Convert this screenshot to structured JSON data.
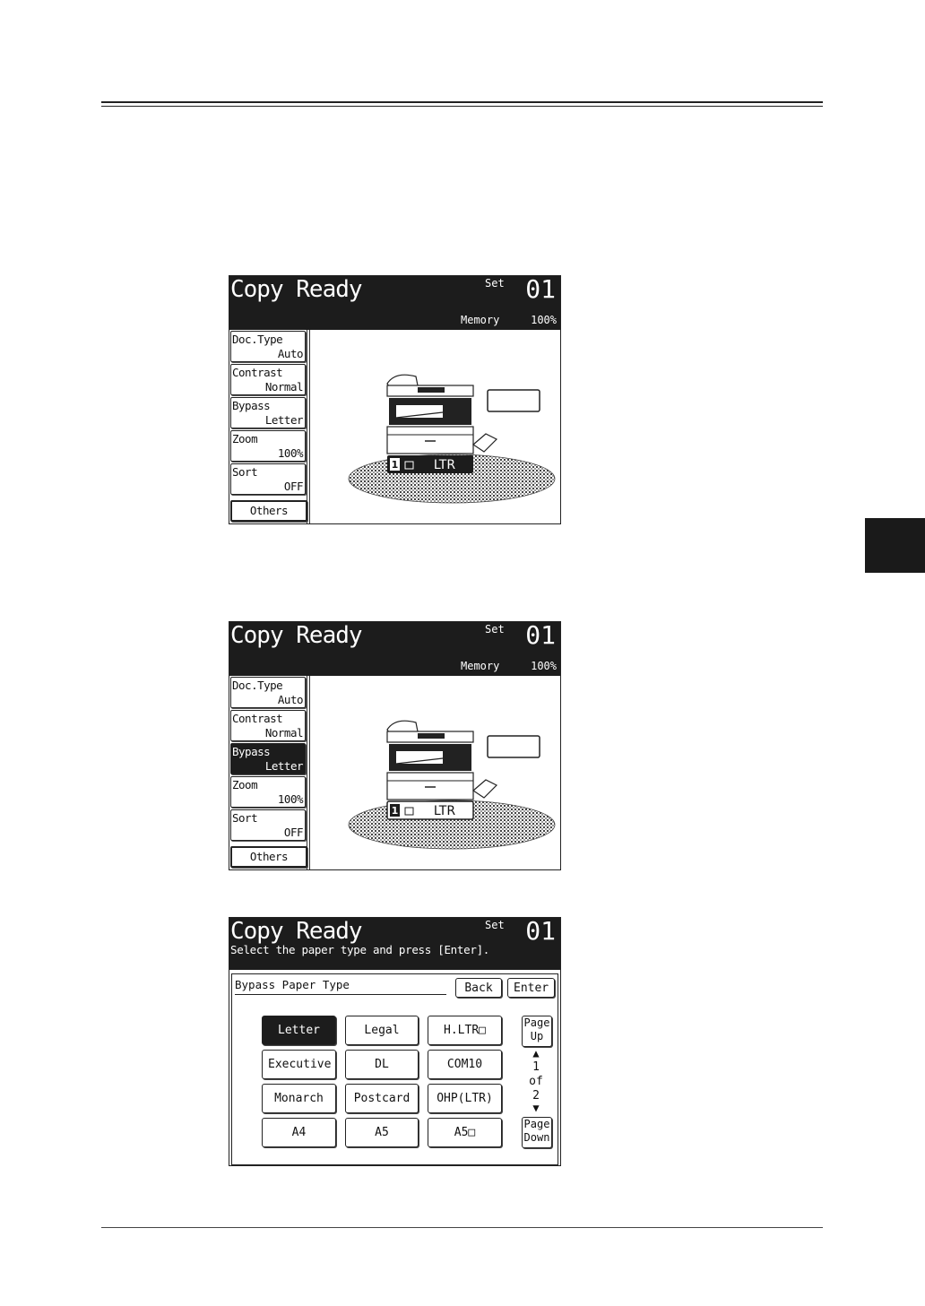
{
  "screens": [
    {
      "title": "Copy Ready",
      "set_label": "Set",
      "set_count": "01",
      "memory_label": "Memory",
      "memory_value": "100%",
      "sidebar": [
        {
          "label": "Doc.Type",
          "value": "Auto"
        },
        {
          "label": "Contrast",
          "value": "Normal"
        },
        {
          "label": "Bypass",
          "value": "Letter"
        },
        {
          "label": "Zoom",
          "value": "100%"
        },
        {
          "label": "Sort",
          "value": "OFF"
        }
      ],
      "others_label": "Others",
      "tray_number": "1",
      "tray_paper": "LTR"
    },
    {
      "title": "Copy Ready",
      "set_label": "Set",
      "set_count": "01",
      "memory_label": "Memory",
      "memory_value": "100%",
      "sidebar": [
        {
          "label": "Doc.Type",
          "value": "Auto"
        },
        {
          "label": "Contrast",
          "value": "Normal"
        },
        {
          "label": "Bypass",
          "value": "Letter",
          "selected": true
        },
        {
          "label": "Zoom",
          "value": "100%"
        },
        {
          "label": "Sort",
          "value": "OFF"
        }
      ],
      "others_label": "Others",
      "tray_number": "1",
      "tray_paper": "LTR"
    },
    {
      "title": "Copy Ready",
      "set_label": "Set",
      "set_count": "01",
      "subtitle": "Select the paper type and press [Enter].",
      "panel_label": "Bypass Paper Type",
      "back_label": "Back",
      "enter_label": "Enter",
      "paper_types": [
        "Letter",
        "Legal",
        "H.LTR□",
        "Executive",
        "DL",
        "COM10",
        "Monarch",
        "Postcard",
        "OHP(LTR)",
        "A4",
        "A5",
        "A5□"
      ],
      "selected_paper": "Letter",
      "page_up": [
        "Page",
        "Up"
      ],
      "page_down": [
        "Page",
        "Down"
      ],
      "page_current": "1",
      "page_of": "of",
      "page_total": "2"
    }
  ],
  "colors": {
    "screen_header": "#1c1c1c",
    "selected": "#1c1c1c",
    "side_tab": "#1a1a1a"
  }
}
